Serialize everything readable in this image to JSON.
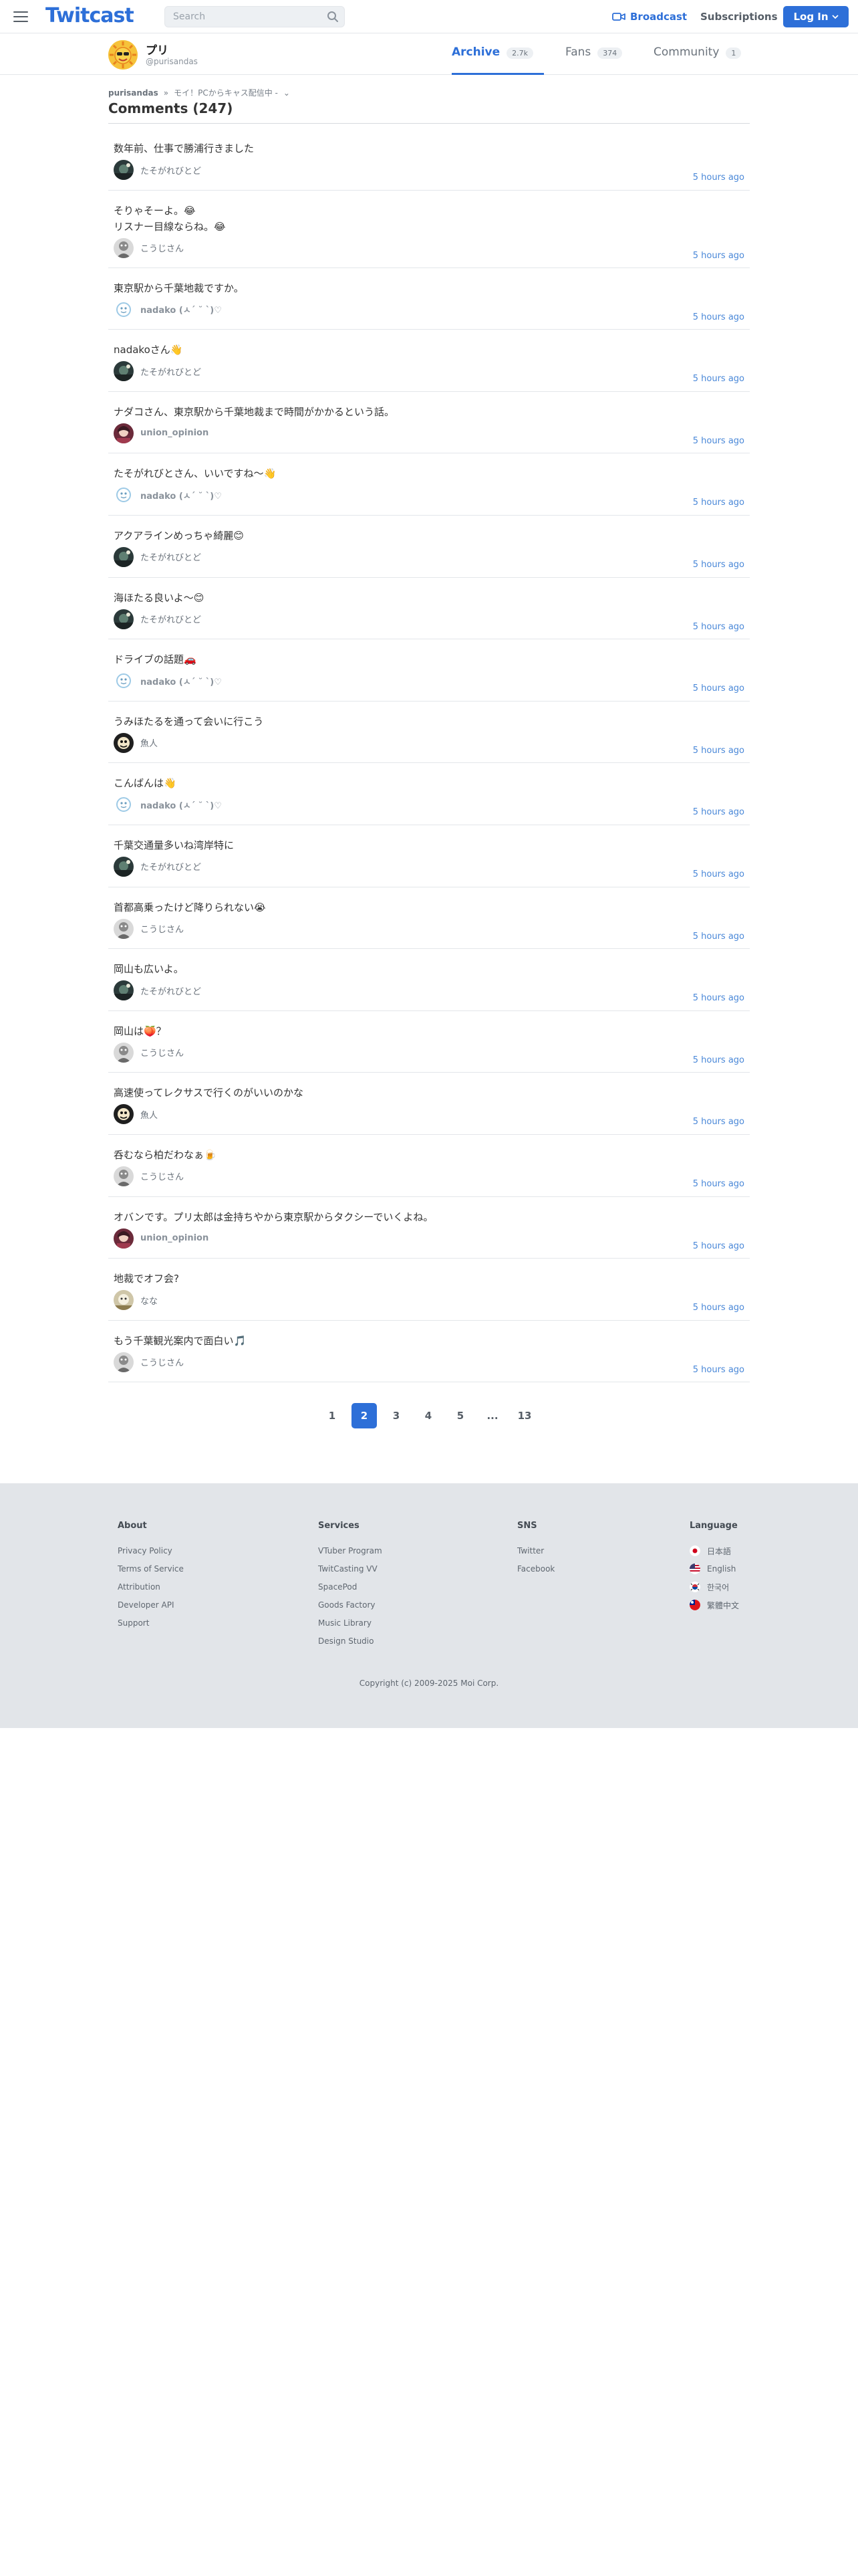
{
  "header": {
    "logo": "Twitcast",
    "search_placeholder": "Search",
    "broadcast": "Broadcast",
    "subscriptions": "Subscriptions",
    "login": "Log In",
    "accent": "#2d6fd8"
  },
  "user": {
    "name": "プリ",
    "handle": "@purisandas",
    "tabs": [
      {
        "label": "Archive",
        "count": "2.7k"
      },
      {
        "label": "Fans",
        "count": "374"
      },
      {
        "label": "Community",
        "count": "1"
      }
    ]
  },
  "breadcrumb": {
    "user": "purisandas",
    "sep": "»",
    "movie": "モイ！PCからキャス配信中 -",
    "chevron": "⌄"
  },
  "page_title": "Comments (247)",
  "comments": [
    {
      "text": "数年前、仕事で勝浦行きました",
      "user": "たそがれびとど",
      "time": "5 hours ago"
    },
    {
      "text": "そりゃそーよ。😂\nリスナー目線ならね。😂",
      "user": "こうじさん",
      "time": "5 hours ago"
    },
    {
      "text": "東京駅から千葉地裁ですか。",
      "user": "nadako (ㅅ´ ˘ `)♡",
      "time": "5 hours ago"
    },
    {
      "text": "nadakoさん👋",
      "user": "たそがれびとど",
      "time": "5 hours ago"
    },
    {
      "text": "ナダコさん、東京駅から千葉地裁まで時間がかかるという話。",
      "user": "union_opinion",
      "time": "5 hours ago"
    },
    {
      "text": "たそがれびとさん、いいですね〜👋",
      "user": "nadako (ㅅ´ ˘ `)♡",
      "time": "5 hours ago"
    },
    {
      "text": "アクアラインめっちゃ綺麗😊",
      "user": "たそがれびとど",
      "time": "5 hours ago"
    },
    {
      "text": "海ほたる良いよ〜😊",
      "user": "たそがれびとど",
      "time": "5 hours ago"
    },
    {
      "text": "ドライブの話題🚗",
      "user": "nadako (ㅅ´ ˘ `)♡",
      "time": "5 hours ago"
    },
    {
      "text": "うみほたるを通って会いに行こう",
      "user": "魚人",
      "time": "5 hours ago"
    },
    {
      "text": "こんばんは👋",
      "user": "nadako (ㅅ´ ˘ `)♡",
      "time": "5 hours ago"
    },
    {
      "text": "千葉交通量多いね湾岸特に",
      "user": "たそがれびとど",
      "time": "5 hours ago"
    },
    {
      "text": "首都高乗ったけど降りられない😭",
      "user": "こうじさん",
      "time": "5 hours ago"
    },
    {
      "text": "岡山も広いよ。",
      "user": "たそがれびとど",
      "time": "5 hours ago"
    },
    {
      "text": "岡山は🍑？",
      "user": "こうじさん",
      "time": "5 hours ago"
    },
    {
      "text": "高速使ってレクサスで行くのがいいのかな",
      "user": "魚人",
      "time": "5 hours ago"
    },
    {
      "text": "呑むなら柏だわなぁ🍺",
      "user": "こうじさん",
      "time": "5 hours ago"
    },
    {
      "text": "オバンです。プリ太郎は金持ちやから東京駅からタクシーでいくよね。",
      "user": "union_opinion",
      "time": "5 hours ago"
    },
    {
      "text": "地裁でオフ会?",
      "user": "なな",
      "time": "5 hours ago"
    },
    {
      "text": "もう千葉観光案内で面白い🎵",
      "user": "こうじさん",
      "time": "5 hours ago"
    }
  ],
  "pagination": [
    "1",
    "2",
    "3",
    "4",
    "5",
    "...",
    "13"
  ],
  "pagination_active": "2",
  "footer": {
    "about": {
      "title": "About",
      "links": [
        "Privacy Policy",
        "Terms of Service",
        "Attribution",
        "Developer API",
        "Support"
      ]
    },
    "services": {
      "title": "Services",
      "links": [
        "VTuber Program",
        "TwitCasting VV",
        "SpacePod",
        "Goods Factory",
        "Music Library",
        "Design Studio"
      ]
    },
    "sns": {
      "title": "SNS",
      "links": [
        "Twitter",
        "Facebook"
      ]
    },
    "language": {
      "title": "Language",
      "options": [
        "日本語",
        "English",
        "한국어",
        "繁體中文"
      ]
    },
    "copyright": "Copyright (c) 2009-2025 Moi Corp."
  }
}
